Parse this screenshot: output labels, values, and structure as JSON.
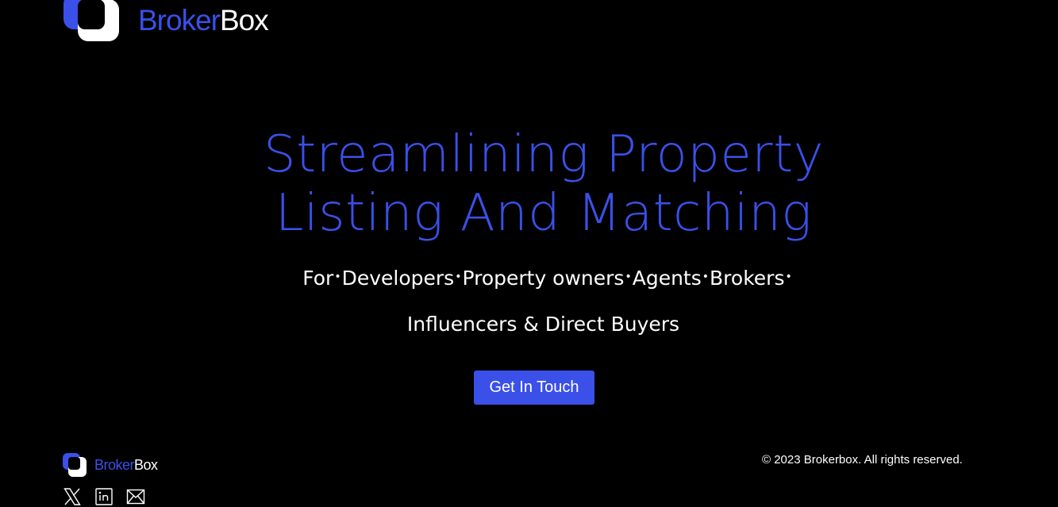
{
  "brand": {
    "name_part1": "Broker",
    "name_part2": "Box",
    "colors": {
      "accent": "#3a50e8",
      "background": "#000000",
      "text": "#ffffff"
    }
  },
  "hero": {
    "title_line1": "Streamlining Property",
    "title_line2": "Listing And Matching",
    "audience": {
      "prefix": "For",
      "items": [
        "Developers",
        "Property owners",
        "Agents",
        "Brokers"
      ],
      "line2": "Influencers & Direct Buyers"
    },
    "cta_label": "Get In Touch"
  },
  "footer": {
    "copyright": "© 2023 Brokerbox. All rights reserved.",
    "socials": [
      {
        "icon": "x-twitter-icon"
      },
      {
        "icon": "linkedin-icon"
      },
      {
        "icon": "mail-icon"
      }
    ]
  }
}
